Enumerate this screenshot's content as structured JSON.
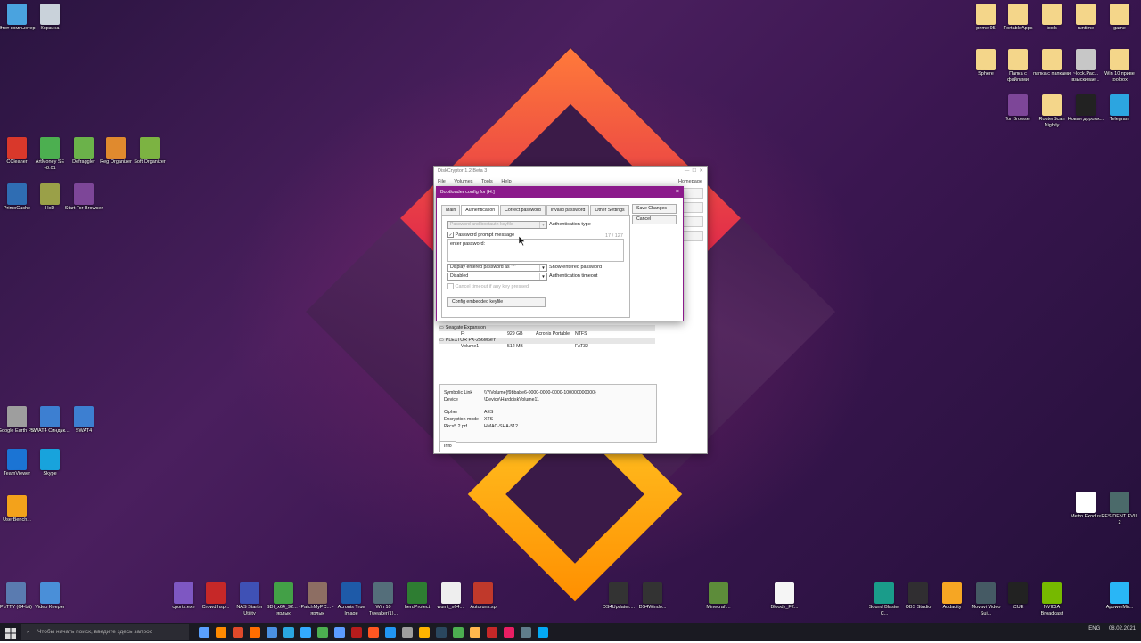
{
  "desktop": {
    "icons_left": [
      {
        "label": "Этот компьютер",
        "color": "#4aa3df"
      },
      {
        "label": "Корзина",
        "color": "#c9d2da"
      },
      {
        "label": "CCleaner",
        "color": "#d9382b"
      },
      {
        "label": "ArtMoney SE v8.01",
        "color": "#4caf50"
      },
      {
        "label": "Defraggler",
        "color": "#6bb24a"
      },
      {
        "label": "Reg Organizer",
        "color": "#e08a2e"
      },
      {
        "label": "Soft Organizer",
        "color": "#7cb342"
      },
      {
        "label": "PrimoCache",
        "color": "#2f6db3"
      },
      {
        "label": "HxD",
        "color": "#9aa048"
      },
      {
        "label": "Start Tor Browser",
        "color": "#7d4698"
      },
      {
        "label": "Google Earth Pro",
        "color": "#9e9e9e"
      },
      {
        "label": "SWAT4 Синдик...",
        "color": "#3d7fd1"
      },
      {
        "label": "SWAT4",
        "color": "#3d7fd1"
      },
      {
        "label": "TeamViewer",
        "color": "#1b74d4"
      },
      {
        "label": "Skype",
        "color": "#18a3dc"
      },
      {
        "label": "UserBench...",
        "color": "#f3a21b"
      }
    ],
    "icons_right": [
      {
        "label": "prime 95",
        "color": "#f4d68a"
      },
      {
        "label": "PortableApps",
        "color": "#f4d68a"
      },
      {
        "label": "tools",
        "color": "#f4d68a"
      },
      {
        "label": "runtime",
        "color": "#f4d68a"
      },
      {
        "label": "game",
        "color": "#f4d68a"
      },
      {
        "label": "Sphere",
        "color": "#f4d68a"
      },
      {
        "label": "Папка с файлами",
        "color": "#f4d68a"
      },
      {
        "label": "папка с папками",
        "color": "#f4d68a"
      },
      {
        "label": "~lock.Рас... взыскиваe...",
        "color": "#c7c7c7"
      },
      {
        "label": "Win 10 приве toolbox",
        "color": "#f4d68a"
      },
      {
        "label": "Tor Browser",
        "color": "#7d4698"
      },
      {
        "label": "RouterScan Nightly",
        "color": "#f4d68a"
      },
      {
        "label": "Новая дорожк...",
        "color": "#222222"
      },
      {
        "label": "Telegram",
        "color": "#2ca5e0"
      },
      {
        "label": "Metro Exodus",
        "color": "#ffffff"
      },
      {
        "label": "RESIDENT EVIL 2",
        "color": "#4b6a6a"
      }
    ],
    "icons_bottom": [
      {
        "label": "PuTTY (64-bit)",
        "color": "#5a7bb0"
      },
      {
        "label": "Video Keeper",
        "color": "#4a8fd8"
      },
      {
        "label": "cports.exe",
        "color": "#7e57c2"
      },
      {
        "label": "CrowdInsp...",
        "color": "#c62828"
      },
      {
        "label": "NAS Starter Utility",
        "color": "#3f51b5"
      },
      {
        "label": "SDI_x64_92... - ярлык",
        "color": "#43a047"
      },
      {
        "label": "PatchMyPC... - ярлык",
        "color": "#8d6e63"
      },
      {
        "label": "Acronis True Image",
        "color": "#1e5aa8"
      },
      {
        "label": "Win 10 Tweaker(1)...",
        "color": "#546e7a"
      },
      {
        "label": "herdProtect",
        "color": "#2e7d32"
      },
      {
        "label": "wumt_x64....",
        "color": "#eeeeee"
      },
      {
        "label": "Autoruns.sp",
        "color": "#c0392b"
      },
      {
        "label": "DS4Updater....",
        "color": "#333333"
      },
      {
        "label": "DS4Windo...",
        "color": "#333333"
      },
      {
        "label": "Minecraft...",
        "color": "#5d8c3a"
      },
      {
        "label": "Bloody_F2...",
        "color": "#f5f5f5"
      },
      {
        "label": "Sound Blaster C...",
        "color": "#1a9c8a"
      },
      {
        "label": "OBS Studio",
        "color": "#302e31"
      },
      {
        "label": "Audacity",
        "color": "#f6a623"
      },
      {
        "label": "Movavi Video Sui...",
        "color": "#455a64"
      },
      {
        "label": "iCUE",
        "color": "#222222"
      },
      {
        "label": "NVIDIA Broadcast",
        "color": "#76b900"
      },
      {
        "label": "ApowerMir...",
        "color": "#29b6f6"
      }
    ]
  },
  "main_window": {
    "title": "DiskCryptor 1.2 Beta 3",
    "menu": [
      "File",
      "Volumes",
      "Tools",
      "Help"
    ],
    "menu_right": "Homepage",
    "volumes": [
      {
        "type": "drive",
        "label": "Seagate Expansion"
      },
      {
        "type": "vol",
        "name": "F:",
        "size": "929 GB",
        "label": "Acronis Portable",
        "fs": "NTFS"
      },
      {
        "type": "drive",
        "label": "PLEXTOR PX-256M6eY"
      },
      {
        "type": "vol",
        "name": "Volume1",
        "size": "512 MB",
        "label": "",
        "fs": "FAT32"
      }
    ],
    "info": [
      {
        "k": "Symbolic Link",
        "v": "\\\\?\\Volume{f9bbabe6-0000-0000-0000-100000000000}"
      },
      {
        "k": "Device",
        "v": "\\Device\\HarddiskVolume11"
      },
      {
        "k": "Cipher",
        "v": "AES"
      },
      {
        "k": "Encryption mode",
        "v": "XTS"
      },
      {
        "k": "Pkcs5.2 prf",
        "v": "HMAC-SHA-512"
      }
    ],
    "info_tab": "Info"
  },
  "dialog": {
    "title": "Bootloader config for [H:]",
    "tabs": [
      "Main",
      "Authentication",
      "Correct password",
      "Invalid password",
      "Other Settings"
    ],
    "active_tab": "Authentication",
    "auth_select": "Password and bootauth keyfile",
    "auth_label": "Authentication type",
    "prompt_checkbox": "Password prompt message",
    "prompt_counter": "17 / 127",
    "prompt_text": "enter password:",
    "display_select": "Display entered password as \"*\"",
    "display_label": "Show entered password",
    "timeout_select": "Disabled",
    "timeout_label": "Authentication timeout",
    "cancel_timeout": "Cancel timeout if any key pressed",
    "keyfile_button": "Config embedded keyfile",
    "save_button": "Save Changes",
    "cancel_button": "Cancel",
    "close": "×",
    "accent": "#8b1a8b"
  },
  "taskbar": {
    "search_placeholder": "Чтобы начать поиск, введите здесь запрос",
    "lang": "ENG",
    "date": "08.02.2021",
    "apps": [
      "#5aa0ff",
      "#ff8a00",
      "#e04a2a",
      "#ff6d00",
      "#4a90e2",
      "#2aa7e0",
      "#33aaff",
      "#4caf50",
      "#5b9cff",
      "#b71c1c",
      "#ff5722",
      "#2196f3",
      "#9e9e9e",
      "#ffb300",
      "#2a475e",
      "#4caf50",
      "#ffb74d",
      "#c62828",
      "#e91e63",
      "#607d8b",
      "#03a9f4"
    ]
  }
}
